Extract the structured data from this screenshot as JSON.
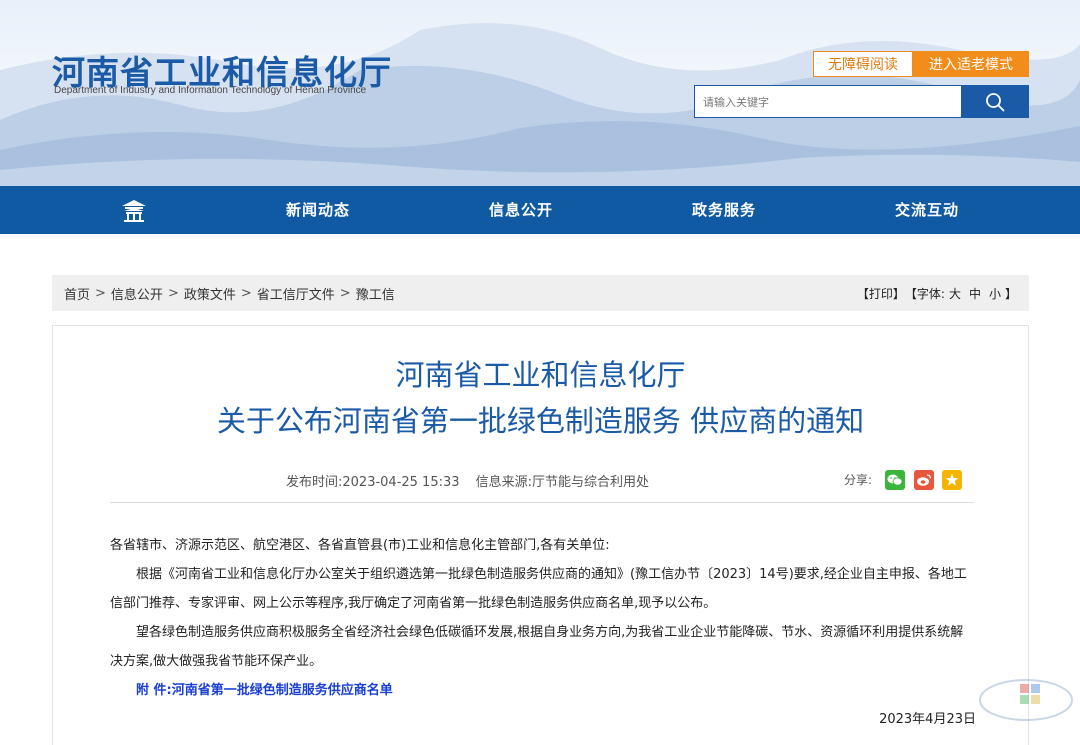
{
  "header": {
    "title_cn": "河南省工业和信息化厅",
    "title_en": "Department of Industry and Information Technology of Henan Province",
    "accessible_label": "无障碍阅读",
    "elderly_label": "进入适老模式",
    "search_placeholder": "请输入关键字",
    "accent_color": "#1a5aa7",
    "orange_color": "#f28c1a"
  },
  "nav": {
    "home_icon": "pavilion-home-icon",
    "items": [
      "新闻动态",
      "信息公开",
      "政务服务",
      "交流互动"
    ]
  },
  "breadcrumb": {
    "items": [
      "首页",
      "信息公开",
      "政策文件",
      "省工信厅文件",
      "豫工信"
    ],
    "separator": ">",
    "print": "【打印】",
    "font_label": "【字体:",
    "font_large": "大",
    "font_medium": "中",
    "font_small": "小",
    "font_close": "】"
  },
  "article": {
    "title_line1": "河南省工业和信息化厅",
    "title_line2": "关于公布河南省第一批绿色制造服务 供应商的通知",
    "publish_time": "发布时间:2023-04-25 15:33",
    "source": "信息来源:厅节能与综合利用处",
    "share_label": "分享:",
    "share_icons": [
      "wechat-icon",
      "weibo-icon",
      "favorite-star-icon"
    ],
    "salutation": "各省辖市、济源示范区、航空港区、各省直管县(市)工业和信息化主管部门,各有关单位:",
    "para1": "根据《河南省工业和信息化厅办公室关于组织遴选第一批绿色制造服务供应商的通知》(豫工信办节〔2023〕14号)要求,经企业自主申报、各地工信部门推荐、专家评审、网上公示等程序,我厅确定了河南省第一批绿色制造服务供应商名单,现予以公布。",
    "para2": "望各绿色制造服务供应商积极服务全省经济社会绿色低碳循环发展,根据自身业务方向,为我省工业企业节能降碳、节水、资源循环利用提供系统解决方案,做大做强我省节能环保产业。",
    "attachment": "附 件:河南省第一批绿色制造服务供应商名单",
    "date": "2023年4月23日"
  }
}
